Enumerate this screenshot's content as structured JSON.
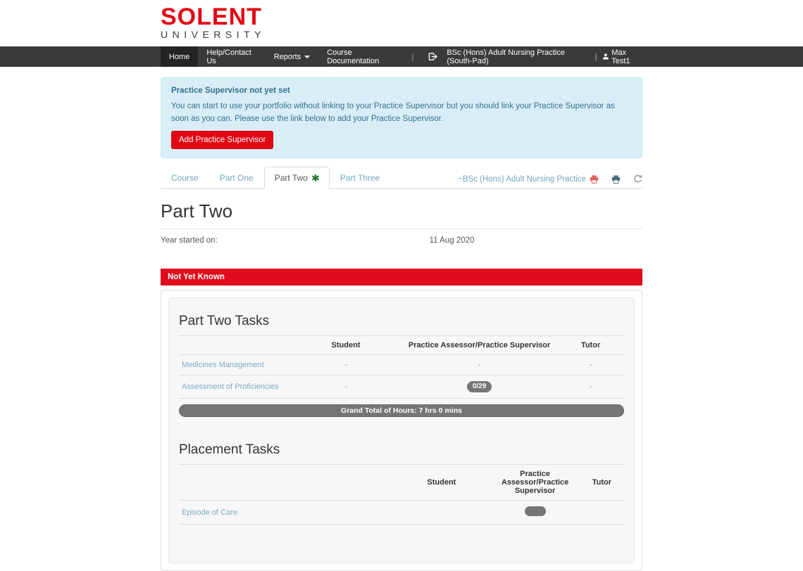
{
  "brand": {
    "line1": "SOLENT",
    "line2": "UNIVERSITY"
  },
  "navbar": {
    "home": "Home",
    "help": "Help/Contact Us",
    "reports": "Reports",
    "course_documentation": "Course Documentation",
    "divider": "|",
    "course": "BSc (Hons) Adult Nursing Practice (South-Pad)",
    "divider2": "|",
    "user": "Max Test1"
  },
  "alert": {
    "title": "Practice Supervisor not yet set",
    "body": "You can start to use your portfolio without linking to your Practice Supervisor but you should link your Practice Supervisor as soon as you can. Please use the link below to add your Practice Supervisor.",
    "button": "Add Practice Supervisor"
  },
  "tabs": {
    "items": [
      {
        "label": "Course"
      },
      {
        "label": "Part One"
      },
      {
        "label": "Part Two"
      },
      {
        "label": "Part Three"
      }
    ],
    "right_link": "~BSc (Hons) Adult Nursing Practice"
  },
  "page": {
    "title": "Part Two",
    "year_started_label": "Year started on:",
    "year_started_value": "11 Aug 2020"
  },
  "status_banner": "Not Yet Known",
  "part_two_tasks": {
    "heading": "Part Two Tasks",
    "columns": [
      "Student",
      "Practice Assessor/Practice Supervisor",
      "Tutor"
    ],
    "rows": [
      {
        "name": "Medicines Management",
        "student": "-",
        "paps": "-",
        "tutor": "-"
      },
      {
        "name": "Assessment of Proficiencies",
        "student": "-",
        "paps_badge": "0/29",
        "tutor": "-"
      }
    ],
    "grand_total": "Grand Total of Hours: 7 hrs 0 mins"
  },
  "placement_tasks": {
    "heading": "Placement Tasks",
    "columns": [
      "Student",
      "Practice Assessor/Practice Supervisor",
      "Tutor"
    ],
    "rows": [
      {
        "name": "Episode of Care"
      }
    ]
  },
  "colors": {
    "accent_red": "#e30613",
    "banner_red": "#e00b1c",
    "info_bg": "#d9edf7",
    "info_text": "#31708f",
    "badge_gray": "#757575",
    "link_blue": "#73a5c0"
  }
}
